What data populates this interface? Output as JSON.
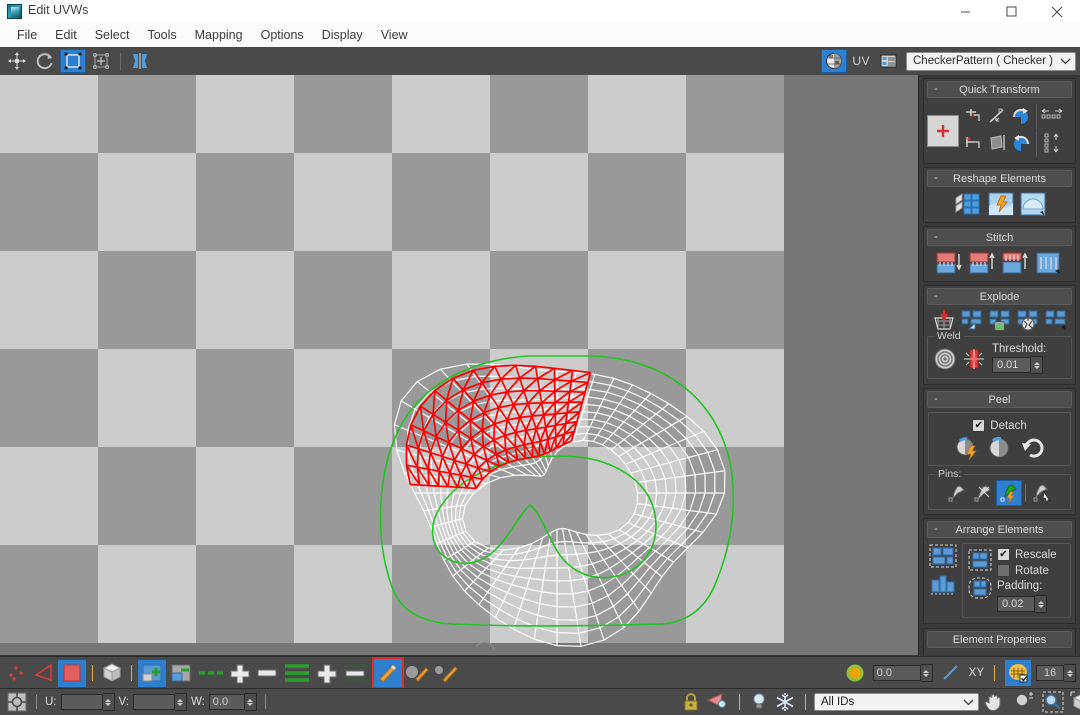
{
  "window": {
    "title": "Edit UVWs",
    "icon": "app-icon",
    "controls": {
      "minimize": "–",
      "maximize": "□",
      "close": "✕"
    }
  },
  "menu": {
    "items": [
      "File",
      "Edit",
      "Select",
      "Tools",
      "Mapping",
      "Options",
      "Display",
      "View"
    ]
  },
  "toolbar": {
    "left_tools": [
      {
        "name": "move-tool",
        "icon": "move-arrows-icon",
        "selected": false
      },
      {
        "name": "rotate-tool",
        "icon": "rotate-circle-icon",
        "selected": false
      },
      {
        "name": "scale-tool",
        "icon": "scale-square-icon",
        "selected": true
      },
      {
        "name": "freeform-mode",
        "icon": "freeform-gizmo-icon",
        "selected": false
      },
      {
        "name": "mirror-tool",
        "icon": "mirror-icon",
        "selected": false
      }
    ],
    "right_tools": [
      {
        "name": "show-map-toggle",
        "icon": "checkered-sphere-icon",
        "selected": true
      },
      {
        "name": "uv-channel",
        "label": "UV",
        "selected": false
      },
      {
        "name": "texture-list",
        "icon": "list-icon",
        "selected": false
      }
    ],
    "map_dropdown": {
      "value": "CheckerPattern  ( Checker )",
      "chevron": "chevron-down-icon"
    }
  },
  "panel": {
    "rollouts": [
      {
        "name": "quick-transform",
        "title": "Quick Transform",
        "collapse": "-",
        "buttons": [
          {
            "name": "move-selected-pivot",
            "icon": "pivot-plus-icon"
          },
          {
            "name": "align-horizontal",
            "icon": "align-h-icon"
          },
          {
            "name": "align-to-edge",
            "icon": "align-edge-icon"
          },
          {
            "name": "rotate-90-ccw",
            "icon": "rotate-ccw-icon"
          },
          {
            "name": "space-horizontal",
            "icon": "space-h-icon"
          },
          {
            "name": "align-vertical",
            "icon": "align-v-icon"
          },
          {
            "name": "align-block",
            "icon": "align-block-icon"
          },
          {
            "name": "rotate-90-cw",
            "icon": "rotate-cw-icon"
          },
          {
            "name": "space-vertical",
            "icon": "space-v-icon"
          }
        ]
      },
      {
        "name": "reshape-elements",
        "title": "Reshape Elements",
        "collapse": "-",
        "buttons": [
          {
            "name": "straighten-selection",
            "icon": "straighten-icon"
          },
          {
            "name": "relax-quick",
            "icon": "relax-bolt-icon"
          },
          {
            "name": "relax-dialog",
            "icon": "relax-dome-icon"
          }
        ]
      },
      {
        "name": "stitch",
        "title": "Stitch",
        "collapse": "-",
        "buttons": [
          {
            "name": "stitch-source",
            "icon": "stitch-down-icon"
          },
          {
            "name": "stitch-target",
            "icon": "stitch-up-icon"
          },
          {
            "name": "stitch-custom",
            "icon": "stitch-custom-icon"
          },
          {
            "name": "stitch-dialog",
            "icon": "stitch-dialog-icon"
          }
        ]
      },
      {
        "name": "explode",
        "title": "Explode",
        "collapse": "-",
        "buttons": [
          {
            "name": "break-selection",
            "icon": "basket-break-icon"
          },
          {
            "name": "break-by-angle",
            "icon": "break-angle-icon"
          },
          {
            "name": "break-by-material",
            "icon": "break-material-icon"
          },
          {
            "name": "break-by-smoothing",
            "icon": "break-smoothing-icon"
          },
          {
            "name": "break-dialog",
            "icon": "break-dialog-icon"
          }
        ],
        "weld": {
          "label": "Weld",
          "buttons": [
            {
              "name": "weld-selected",
              "icon": "weld-target-icon"
            },
            {
              "name": "target-weld",
              "icon": "target-weld-icon"
            }
          ],
          "threshold_label": "Threshold:",
          "threshold_value": "0.01"
        }
      },
      {
        "name": "peel",
        "title": "Peel",
        "collapse": "-",
        "detach": {
          "label": "Detach",
          "checked": true
        },
        "buttons": [
          {
            "name": "quick-peel",
            "icon": "peel-bolt-icon"
          },
          {
            "name": "peel-mode",
            "icon": "peel-mode-icon"
          },
          {
            "name": "peel-reset",
            "icon": "peel-reset-icon"
          }
        ],
        "pins": {
          "label": "Pins:",
          "buttons": [
            {
              "name": "pin-selected",
              "icon": "pin-icon",
              "selected": false
            },
            {
              "name": "unpin-selected",
              "icon": "unpin-icon",
              "selected": false
            },
            {
              "name": "pin-auto",
              "icon": "pin-bolt-icon",
              "selected": true
            },
            {
              "name": "filter-pins",
              "icon": "pin-cursor-icon",
              "selected": false
            }
          ]
        }
      },
      {
        "name": "arrange-elements",
        "title": "Arrange Elements",
        "collapse": "-",
        "buttons": [
          {
            "name": "pack-normalize",
            "icon": "pack-full-icon"
          },
          {
            "name": "pack-linear",
            "icon": "pack-linear-icon"
          },
          {
            "name": "pack-custom-a",
            "icon": "pack-dashed-a-icon"
          },
          {
            "name": "pack-custom-b",
            "icon": "pack-dashed-b-icon"
          }
        ],
        "rescale": {
          "label": "Rescale",
          "checked": true
        },
        "rotate": {
          "label": "Rotate",
          "checked": false
        },
        "padding_label": "Padding:",
        "padding_value": "0.02"
      },
      {
        "name": "element-properties",
        "title": "Element Properties",
        "collapse": "-",
        "clipped": true
      }
    ]
  },
  "canvas": {
    "checker": {
      "light": "#cccccc",
      "dark": "#999999",
      "background": "#767676",
      "cell_size": 98,
      "cols": 8,
      "rows": 6
    },
    "mesh": {
      "outline_color": "#22c322",
      "wire_color": "#ffffff",
      "selection_color": "#ff0000"
    }
  },
  "bottom_bar_1": {
    "tools": [
      {
        "name": "vertex-subobject",
        "icon": "vertex-dots-icon",
        "selected": false
      },
      {
        "name": "edge-subobject",
        "icon": "edge-triangle-icon",
        "selected": false
      },
      {
        "name": "face-subobject",
        "icon": "face-square-icon",
        "selected": true
      },
      {
        "name": "element-subobject",
        "icon": "element-cube-icon",
        "selected": false
      },
      {
        "name": "select-by-element-add",
        "icon": "element-plus-icon",
        "selected": true
      },
      {
        "name": "select-by-element-sub",
        "icon": "element-minus-icon",
        "selected": false
      },
      {
        "name": "loop-dashed",
        "icon": "edge-loop-dashes-icon",
        "selected": false
      },
      {
        "name": "grow-loop",
        "icon": "grow-plus-icon",
        "selected": false
      },
      {
        "name": "shrink-loop",
        "icon": "shrink-minus-icon",
        "selected": false
      },
      {
        "name": "ring-green",
        "icon": "ring-lines-icon",
        "selected": false
      },
      {
        "name": "grow-ring",
        "icon": "ring-plus-icon",
        "selected": false
      },
      {
        "name": "shrink-ring",
        "icon": "ring-minus-icon",
        "selected": false
      },
      {
        "name": "paint-select",
        "icon": "paint-brush-blue-icon",
        "selected": true,
        "highlight": "red"
      },
      {
        "name": "paint-soft-sel",
        "icon": "paint-sphere-icon",
        "selected": false
      },
      {
        "name": "paint-brush-options",
        "icon": "paint-brush-icon",
        "selected": false
      }
    ],
    "soft_selection": {
      "falloff_icon": "soft-selection-sphere-icon",
      "falloff_value": "0.0",
      "edge-distance-icon": "edge-distance-icon",
      "axis_label": "XY",
      "grid_toggle": {
        "name": "texture-seam-display",
        "icon": "texture-grid-icon",
        "selected": true
      },
      "grid_value": "16"
    }
  },
  "bottom_bar_2": {
    "pivot": {
      "name": "transform-center",
      "icon": "pivot-center-icon"
    },
    "u": {
      "label": "U:",
      "value": ""
    },
    "v": {
      "label": "V:",
      "value": ""
    },
    "w": {
      "label": "W:",
      "value": "0.0"
    },
    "right_tools": [
      {
        "name": "lock-selection",
        "icon": "lock-icon",
        "selected": false
      },
      {
        "name": "filter-selected-faces",
        "icon": "arrow-bulb-icon",
        "selected": false
      },
      {
        "name": "show-hidden-edges",
        "icon": "bulb-icon",
        "selected": false
      },
      {
        "name": "freeze-elements",
        "icon": "snowflake-icon",
        "selected": false
      }
    ],
    "material_ids": {
      "value": "All IDs",
      "chevron": "chevron-down-icon"
    },
    "view_tools": [
      {
        "name": "pan-view",
        "icon": "hand-icon",
        "selected": false
      },
      {
        "name": "zoom-view",
        "icon": "magnifier-plusminus-icon",
        "selected": false
      },
      {
        "name": "zoom-region",
        "icon": "zoom-region-icon",
        "selected": false
      },
      {
        "name": "zoom-extents",
        "icon": "zoom-extents-cube-icon",
        "selected": false
      },
      {
        "name": "snap-toggle",
        "icon": "snap-magnet-grid-icon",
        "selected": false
      }
    ]
  }
}
